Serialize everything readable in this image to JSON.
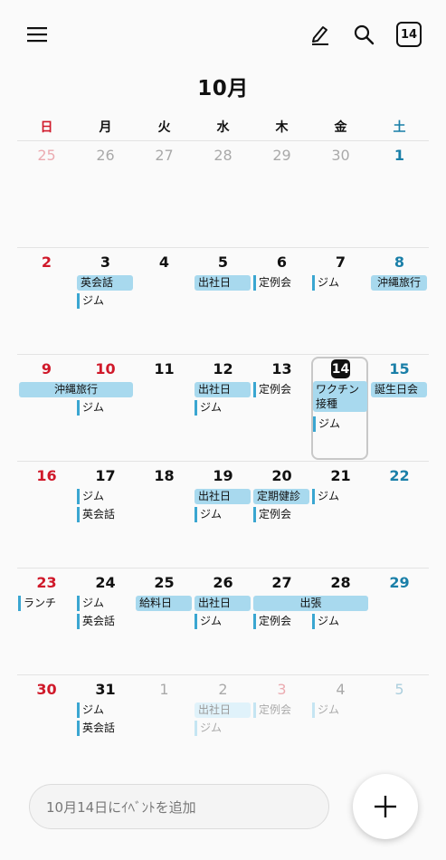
{
  "header": {
    "today_badge": "14",
    "month_title": "10月"
  },
  "icons": {
    "menu": "hamburger-menu-icon",
    "edit": "pen-icon",
    "search": "search-icon",
    "today": "calendar-today-icon",
    "add": "plus-icon"
  },
  "weekdays": [
    "日",
    "月",
    "火",
    "水",
    "木",
    "金",
    "土"
  ],
  "colors": {
    "sunday": "#d0192a",
    "saturday": "#1a7fa8",
    "event_block": "#a8d9ee",
    "event_bar": "#3aa6d1"
  },
  "weeks": [
    [
      "25",
      "26",
      "27",
      "28",
      "29",
      "30",
      "1"
    ],
    [
      "2",
      "3",
      "4",
      "5",
      "6",
      "7",
      "8"
    ],
    [
      "9",
      "10",
      "11",
      "12",
      "13",
      "14",
      "15"
    ],
    [
      "16",
      "17",
      "18",
      "19",
      "20",
      "21",
      "22"
    ],
    [
      "23",
      "24",
      "25",
      "26",
      "27",
      "28",
      "29"
    ],
    [
      "30",
      "31",
      "1",
      "2",
      "3",
      "4",
      "5"
    ]
  ],
  "events": {
    "eikaiwa": "英会話",
    "gym": "ジム",
    "shusha": "出社日",
    "teireikai": "定例会",
    "okinawa": "沖縄旅行",
    "vaccine": "ワクチン接種",
    "birthday": "誕生日会",
    "kenshin": "定期健診",
    "lunch": "ランチ",
    "payday": "給料日",
    "shutcho": "出張"
  },
  "footer": {
    "add_event_placeholder": "10月14日にｲﾍﾞﾝﾄを追加"
  }
}
